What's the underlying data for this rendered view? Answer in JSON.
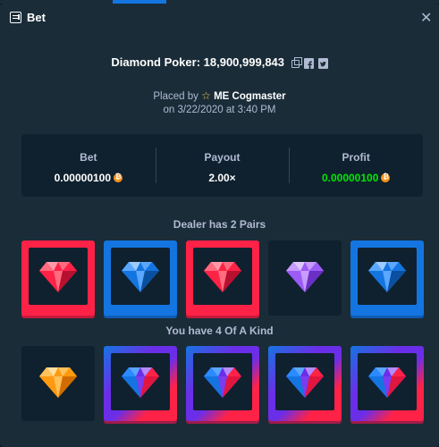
{
  "header": {
    "title": "Bet",
    "close_icon": "close-icon"
  },
  "bet": {
    "game_title": "Diamond Poker: 18,900,999,843",
    "placed_prefix": "Placed by",
    "user": "ME Cogmaster",
    "date_line": "on 3/22/2020 at 3:40 PM"
  },
  "stats": {
    "bet_label": "Bet",
    "bet_value": "0.00000100",
    "payout_label": "Payout",
    "payout_value": "2.00×",
    "profit_label": "Profit",
    "profit_value": "0.00000100"
  },
  "dealer": {
    "label": "Dealer has 2 Pairs",
    "gems": [
      "red",
      "blue",
      "red",
      "purple",
      "blue"
    ]
  },
  "player": {
    "label": "You have 4 Of A Kind",
    "gems": [
      "orange",
      "duo",
      "duo",
      "duo",
      "duo"
    ]
  },
  "colors": {
    "background": "#1a2c38",
    "panel": "#0f212e",
    "red": "#fe2247",
    "blue": "#1475e1",
    "profit_green": "#00e701",
    "coin": "#f7931a"
  }
}
